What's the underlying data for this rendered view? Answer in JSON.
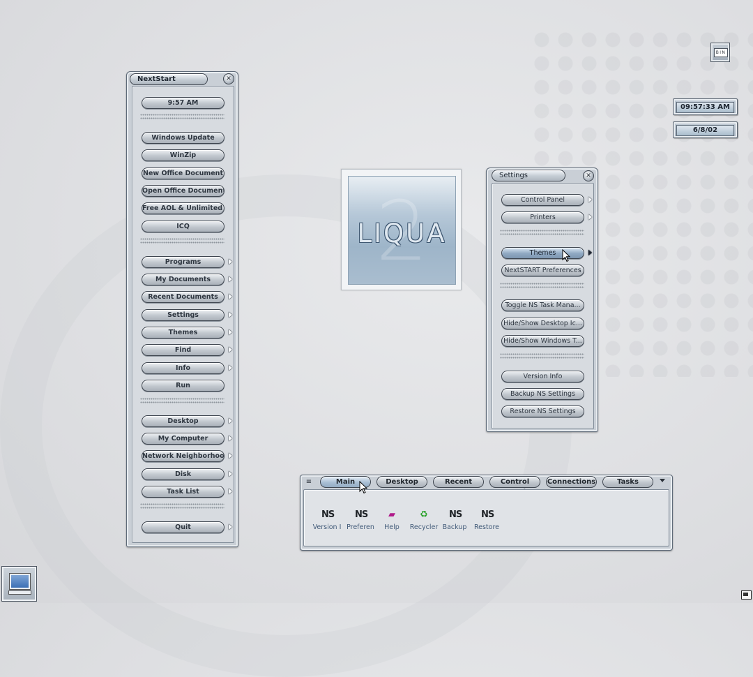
{
  "nextstart": {
    "title": "NextStart",
    "time": "9:57 AM",
    "items_group1": [
      "Windows Update",
      "WinZip",
      "New Office Document",
      "Open Office Document",
      "Free AOL & Unlimited ...",
      "ICQ"
    ],
    "items_group2": [
      "Programs",
      "My Documents",
      "Recent Documents",
      "Settings",
      "Themes",
      "Find",
      "Info",
      "Run"
    ],
    "items_group3": [
      "Desktop",
      "My Computer",
      "Network Neighborhood",
      "Disk",
      "Task List"
    ],
    "quit": "Quit"
  },
  "liqua_logo": {
    "text": "LIQUA",
    "numeral": "2"
  },
  "settings_menu": {
    "title": "Settings",
    "items_group1": [
      "Control Panel",
      "Printers"
    ],
    "items_group2": [
      "Themes",
      "NextSTART Preferences"
    ],
    "items_group3": [
      "Toggle NS Task Mana...",
      "Hide/Show Desktop Ic...",
      "Hide/Show Windows T..."
    ],
    "items_group4": [
      "Version Info",
      "Backup NS Settings",
      "Restore NS Settings"
    ]
  },
  "clock": {
    "time": "09:57:33 AM",
    "date": "6/8/02"
  },
  "bin_widget": {
    "label": "BIN"
  },
  "taskbar": {
    "menu_glyph": "≡",
    "tabs": [
      "Main",
      "Desktop",
      "Recent",
      "Control Panel",
      "Connections",
      "Tasks"
    ],
    "active_tab": "Main",
    "quick_items": [
      {
        "label": "Version I",
        "icon": "ns-icon"
      },
      {
        "label": "Preferen",
        "icon": "ns-icon"
      },
      {
        "label": "Help",
        "icon": "help-book-icon"
      },
      {
        "label": "Recycler",
        "icon": "recycle-icon"
      },
      {
        "label": "Backup",
        "icon": "ns-icon"
      },
      {
        "label": "Restore",
        "icon": "ns-icon"
      }
    ]
  },
  "colors": {
    "panel": "#c9cfd6",
    "accent_blue": "#8fa8c2",
    "label_blue": "#415a78"
  }
}
